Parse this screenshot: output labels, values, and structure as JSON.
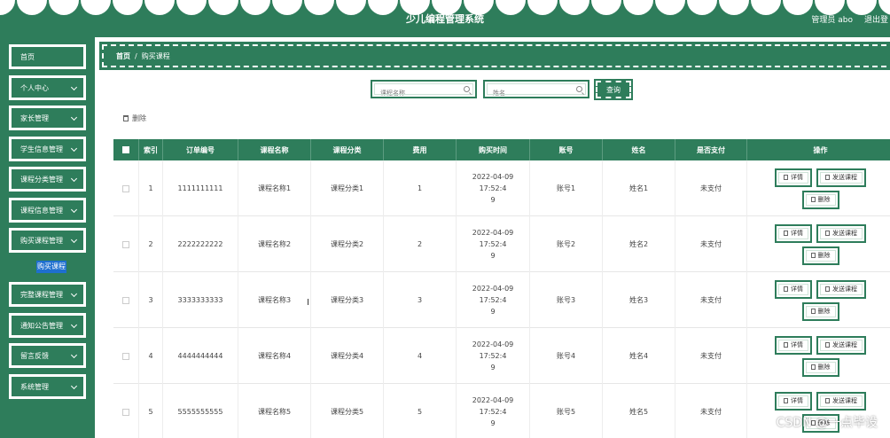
{
  "header": {
    "title": "少儿编程管理系统",
    "user": "管理员 abo",
    "logout": "退出登"
  },
  "sidebar": {
    "items": [
      {
        "label": "首页"
      },
      {
        "label": "个人中心"
      },
      {
        "label": "家长管理"
      },
      {
        "label": "学生信息管理"
      },
      {
        "label": "课程分类管理"
      },
      {
        "label": "课程信息管理"
      },
      {
        "label": "购买课程管理"
      },
      {
        "label": "完整课程管理"
      },
      {
        "label": "通知公告管理"
      },
      {
        "label": "留言反馈"
      },
      {
        "label": "系统管理"
      }
    ],
    "active_sub": "购买课程"
  },
  "breadcrumb": {
    "home": "首页",
    "sep": "/",
    "current": "购买课程"
  },
  "search": {
    "course_name_placeholder": "课程名称",
    "name_placeholder": "姓名",
    "query_label": "查询"
  },
  "toolbar": {
    "delete_label": "删除"
  },
  "table": {
    "columns": [
      "索引",
      "订单编号",
      "课程名称",
      "课程分类",
      "费用",
      "购买时间",
      "账号",
      "姓名",
      "是否支付",
      "操作"
    ],
    "rows": [
      {
        "index": "1",
        "order_no": "1111111111",
        "course_name": "课程名称1",
        "category": "课程分类1",
        "fee": "1",
        "time_a": "2022-04-09 17:52:4",
        "time_b": "9",
        "account": "账号1",
        "name": "姓名1",
        "paid": "未支付"
      },
      {
        "index": "2",
        "order_no": "2222222222",
        "course_name": "课程名称2",
        "category": "课程分类2",
        "fee": "2",
        "time_a": "2022-04-09 17:52:4",
        "time_b": "9",
        "account": "账号2",
        "name": "姓名2",
        "paid": "未支付"
      },
      {
        "index": "3",
        "order_no": "3333333333",
        "course_name": "课程名称3",
        "category": "课程分类3",
        "fee": "3",
        "time_a": "2022-04-09 17:52:4",
        "time_b": "9",
        "account": "账号3",
        "name": "姓名3",
        "paid": "未支付"
      },
      {
        "index": "4",
        "order_no": "4444444444",
        "course_name": "课程名称4",
        "category": "课程分类4",
        "fee": "4",
        "time_a": "2022-04-09 17:52:4",
        "time_b": "9",
        "account": "账号4",
        "name": "姓名4",
        "paid": "未支付"
      },
      {
        "index": "5",
        "order_no": "5555555555",
        "course_name": "课程名称5",
        "category": "课程分类5",
        "fee": "5",
        "time_a": "2022-04-09 17:52:4",
        "time_b": "9",
        "account": "账号5",
        "name": "姓名5",
        "paid": "未支付"
      }
    ],
    "actions": {
      "detail": "详情",
      "send": "发送课程",
      "delete": "删除"
    }
  },
  "watermark": "CSDN @一点毕设",
  "colors": {
    "primary": "#2e7d5b",
    "active_sub": "#1e6fcf"
  }
}
